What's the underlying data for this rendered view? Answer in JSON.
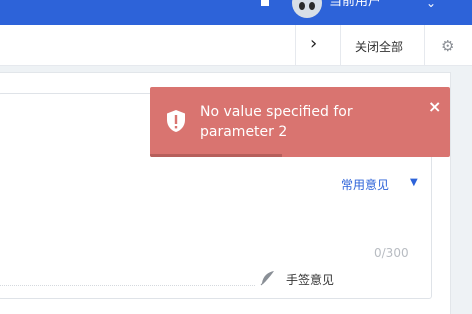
{
  "header": {
    "user_name": "当前用户",
    "accent": "#2d63d9"
  },
  "tabbar": {
    "close_all_label": "关闭全部",
    "more_icon": "chevron-right-icon",
    "settings_icon": "gear-icon"
  },
  "opinion": {
    "common_label": "常用意见",
    "counter": "0/300",
    "sign_label": "手签意见"
  },
  "toast": {
    "message": "No value specified for parameter 2",
    "close_glyph": "×",
    "color": "#d97470",
    "progress": 0.44
  }
}
